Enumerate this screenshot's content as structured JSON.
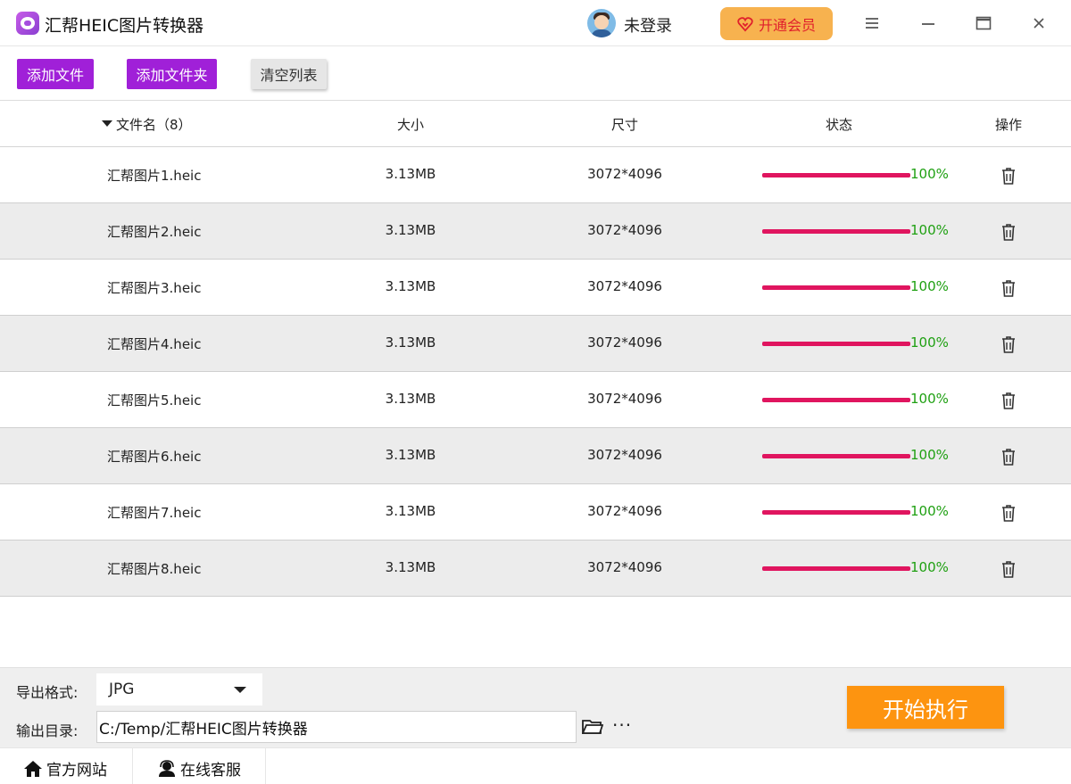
{
  "app": {
    "title": "汇帮HEIC图片转换器"
  },
  "header": {
    "login_label": "未登录",
    "vip_label": "开通会员"
  },
  "toolbar": {
    "add_file": "添加文件",
    "add_folder": "添加文件夹",
    "clear_list": "清空列表"
  },
  "table": {
    "headers": {
      "name": "文件名（8）",
      "size": "大小",
      "dim": "尺寸",
      "status": "状态",
      "action": "操作"
    },
    "rows": [
      {
        "name": "汇帮图片1.heic",
        "size": "3.13MB",
        "dim": "3072*4096",
        "progress": 100,
        "status": "100%"
      },
      {
        "name": "汇帮图片2.heic",
        "size": "3.13MB",
        "dim": "3072*4096",
        "progress": 100,
        "status": "100%"
      },
      {
        "name": "汇帮图片3.heic",
        "size": "3.13MB",
        "dim": "3072*4096",
        "progress": 100,
        "status": "100%"
      },
      {
        "name": "汇帮图片4.heic",
        "size": "3.13MB",
        "dim": "3072*4096",
        "progress": 100,
        "status": "100%"
      },
      {
        "name": "汇帮图片5.heic",
        "size": "3.13MB",
        "dim": "3072*4096",
        "progress": 100,
        "status": "100%"
      },
      {
        "name": "汇帮图片6.heic",
        "size": "3.13MB",
        "dim": "3072*4096",
        "progress": 100,
        "status": "100%"
      },
      {
        "name": "汇帮图片7.heic",
        "size": "3.13MB",
        "dim": "3072*4096",
        "progress": 100,
        "status": "100%"
      },
      {
        "name": "汇帮图片8.heic",
        "size": "3.13MB",
        "dim": "3072*4096",
        "progress": 100,
        "status": "100%"
      }
    ]
  },
  "output": {
    "format_label": "导出格式:",
    "format_value": "JPG",
    "dir_label": "输出目录:",
    "dir_value": "C:/Temp/汇帮HEIC图片转换器",
    "more_label": "···",
    "start_label": "开始执行"
  },
  "footer": {
    "website": "官方网站",
    "support": "在线客服"
  },
  "colors": {
    "accent_purple": "#a020d8",
    "progress": "#e0155f",
    "success": "#1fa012",
    "start": "#fd9410",
    "vip": "#f7b24f"
  }
}
